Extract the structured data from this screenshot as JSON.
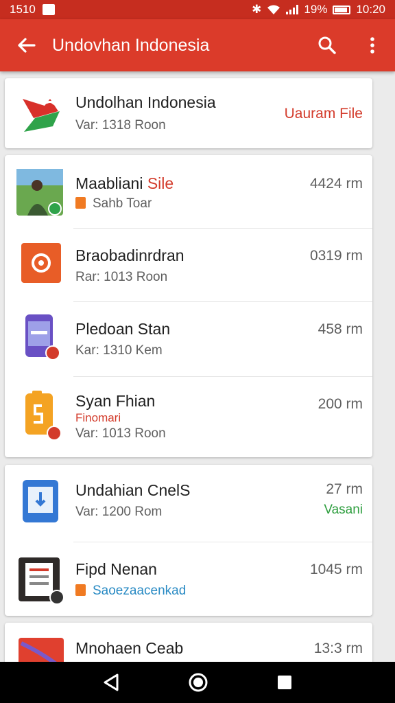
{
  "status_bar": {
    "left_text": "1510",
    "battery": "19%",
    "time": "10:20"
  },
  "app_bar": {
    "title": "Undovhan Indonesia"
  },
  "header_card": {
    "title": "Undolhan Indonesia",
    "subtitle": "Var: 1318 Roon",
    "action": "Uauram File"
  },
  "group1": [
    {
      "name_main": "Maabliani",
      "name_accent": "Sile",
      "sub": "Sahb Toar",
      "size": "4424 rm"
    },
    {
      "name_main": "Braobadinrdran",
      "sub": "Rar: 1013 Roon",
      "size": "0319 rm"
    },
    {
      "name_main": "Pledoan Stan",
      "sub": "Kar: 1310 Kem",
      "size": "458 rm"
    },
    {
      "name_main": "Syan Fhian",
      "tag": "Finomari",
      "sub": "Var: 1013 Roon",
      "size": "200 rm"
    }
  ],
  "group2": [
    {
      "name_main": "Undahian CnelS",
      "sub": "Var: 1200 Rom",
      "size": "27 rm",
      "status": "Vasani"
    },
    {
      "name_main": "Fipd Nenan",
      "sub": "Saoezaacenkad",
      "size": "1045 rm"
    }
  ],
  "group3": [
    {
      "name_main": "Mnohaen Ceab",
      "size": "13:3 rm"
    }
  ],
  "colors": {
    "status_bar": "#c62d1f",
    "app_bar": "#db3b2a",
    "accent_red": "#d33b2b",
    "accent_green": "#2e9e3f"
  },
  "icons": [
    "back-arrow-icon",
    "search-icon",
    "more-vert-icon",
    "back-nav-icon",
    "home-nav-icon",
    "recents-nav-icon"
  ]
}
